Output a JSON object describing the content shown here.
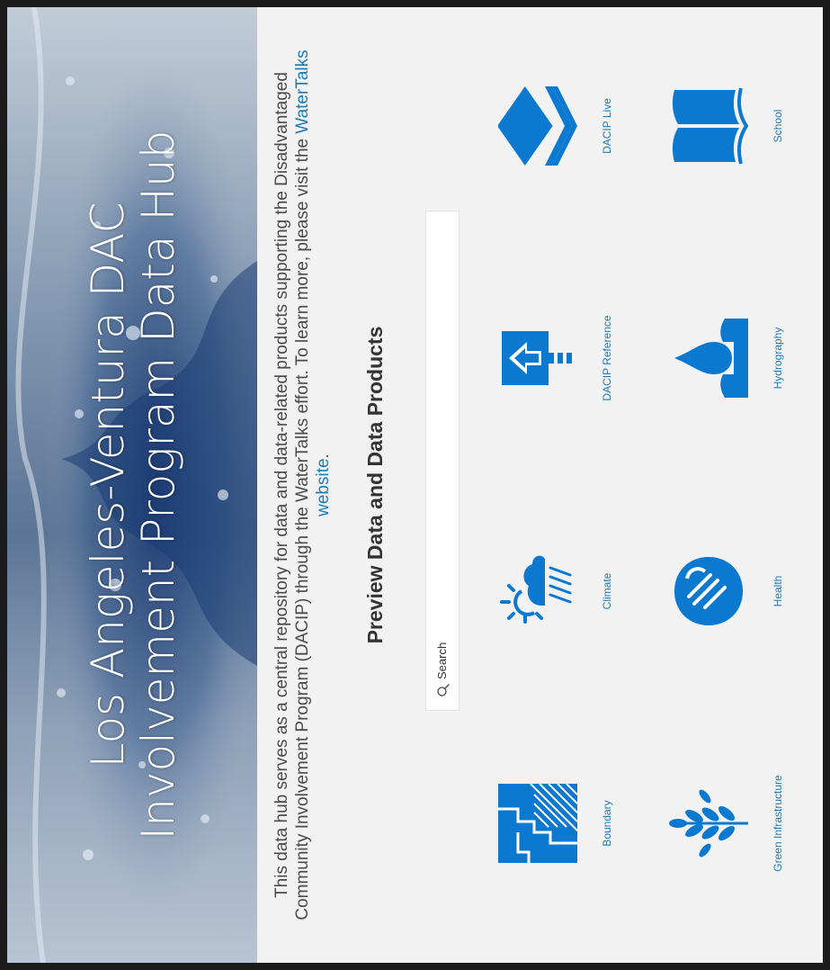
{
  "hero": {
    "title_line1": "Los Angeles-Ventura DAC",
    "title_line2": "Involvement Program Data Hub"
  },
  "intro": {
    "text_before": "This data hub serves as a central repository for data and data-related products supporting the Disadvantaged Community Involvement Program (DACIP) through the WaterTalks effort. To learn more, please visit the ",
    "link_text": "WaterTalks website",
    "text_after": "."
  },
  "section": {
    "title": "Preview Data and Data Products"
  },
  "search": {
    "placeholder": "Search"
  },
  "categories": [
    {
      "label": "Boundary",
      "icon": "boundary-icon"
    },
    {
      "label": "Climate",
      "icon": "climate-icon"
    },
    {
      "label": "DACIP Reference",
      "icon": "reference-icon"
    },
    {
      "label": "DACIP Live",
      "icon": "layers-icon"
    },
    {
      "label": "Green Infrastructure",
      "icon": "wheat-icon"
    },
    {
      "label": "Health",
      "icon": "health-hand-icon"
    },
    {
      "label": "Hydrography",
      "icon": "water-drop-icon"
    },
    {
      "label": "School",
      "icon": "book-icon"
    }
  ],
  "colors": {
    "accent": "#1f7ab8",
    "icon_blue": "#0b79d0",
    "background": "#f2f2f2"
  }
}
